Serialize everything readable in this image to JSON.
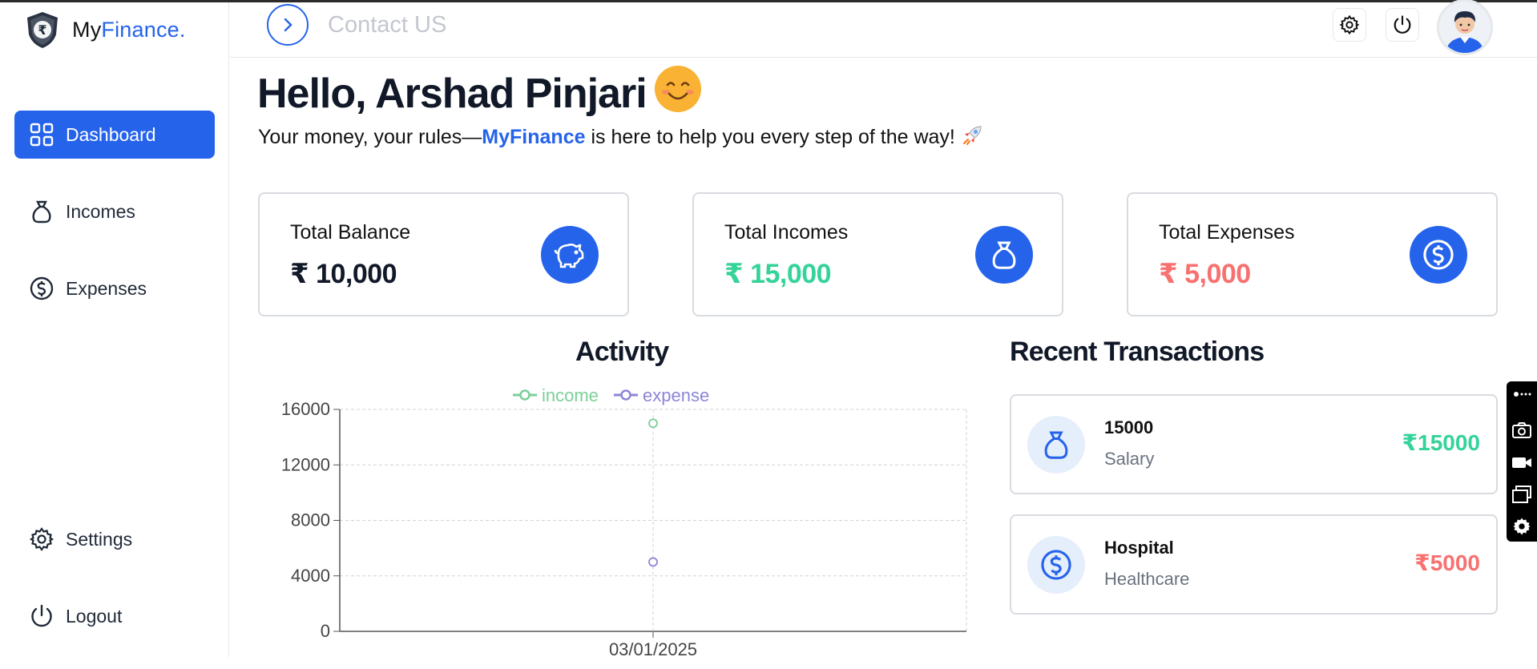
{
  "brand": {
    "prefix": "My",
    "accent": "Finance."
  },
  "sidebar": {
    "items": [
      {
        "label": "Dashboard",
        "icon": "grid-icon",
        "active": true
      },
      {
        "label": "Incomes",
        "icon": "money-bag-icon"
      },
      {
        "label": "Expenses",
        "icon": "dollar-circle-icon"
      }
    ],
    "bottom": [
      {
        "label": "Settings",
        "icon": "gear-icon"
      },
      {
        "label": "Logout",
        "icon": "power-icon"
      }
    ]
  },
  "header": {
    "contact_label": "Contact US"
  },
  "greeting": {
    "title": "Hello, Arshad Pinjari",
    "sub_before": "Your money, your rules—",
    "sub_brand": "MyFinance",
    "sub_after": " is here to help you every step of the way!"
  },
  "cards": [
    {
      "title": "Total Balance",
      "value": "₹ 10,000",
      "color": "#111827",
      "icon": "piggy-bank-icon"
    },
    {
      "title": "Total Incomes",
      "value": "₹ 15,000",
      "color": "#34d399",
      "icon": "money-bag-icon"
    },
    {
      "title": "Total Expenses",
      "value": "₹ 5,000",
      "color": "#f87171",
      "icon": "dollar-circle-icon"
    }
  ],
  "activity": {
    "title": "Activity"
  },
  "recent": {
    "title": "Recent Transactions",
    "items": [
      {
        "title": "15000",
        "category": "Salary",
        "amount": "₹15000",
        "color": "#34d399",
        "icon": "money-bag-icon"
      },
      {
        "title": "Hospital",
        "category": "Healthcare",
        "amount": "₹5000",
        "color": "#f87171",
        "icon": "dollar-circle-icon"
      }
    ]
  },
  "chart_data": {
    "type": "line",
    "title": "Activity",
    "x": [
      "03/01/2025"
    ],
    "series": [
      {
        "name": "income",
        "values": [
          15000
        ],
        "color": "#7ccf98"
      },
      {
        "name": "expense",
        "values": [
          5000
        ],
        "color": "#8c86d8"
      }
    ],
    "yticks": [
      "0",
      "4000",
      "8000",
      "12000",
      "16000"
    ],
    "ylim": [
      0,
      16000
    ],
    "grid": true,
    "legend": "top"
  }
}
